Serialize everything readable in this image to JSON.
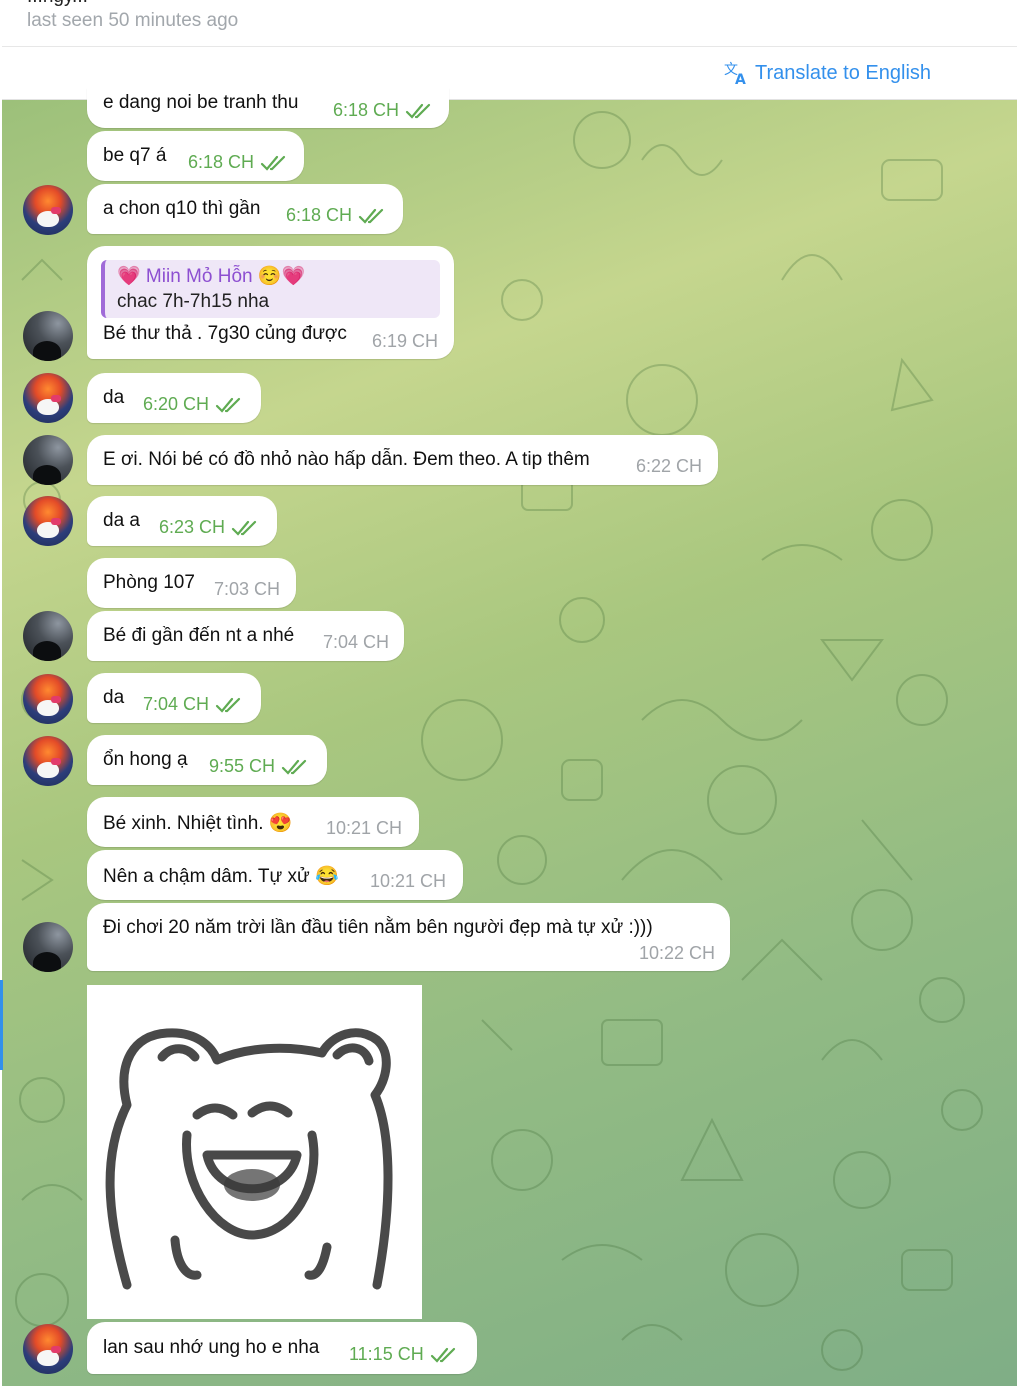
{
  "header": {
    "title": "...ngy...",
    "status": "last seen 50 minutes ago"
  },
  "translate": {
    "label": "Translate to English",
    "color": "#3390ec"
  },
  "colors": {
    "outgoing_time": "#5fab52",
    "incoming_time": "#a0a4a8",
    "quote_accent": "#a06bd8"
  },
  "messages": [
    {
      "text": "e dang noi be tranh thu",
      "time": "6:18 CH"
    },
    {
      "text": "be q7 á",
      "time": "6:18 CH"
    },
    {
      "text": "a chon q10 thì gần",
      "time": "6:18 CH"
    },
    {
      "text": "Bé thư thả . 7g30 củng được",
      "time": "6:19 CH",
      "reply": {
        "name": "💗 Miin Mỏ Hỗn ☺️💗",
        "text": "chac 7h-7h15 nha"
      }
    },
    {
      "text": "da",
      "time": "6:20 CH"
    },
    {
      "text": "E ơi. Nói bé có đồ nhỏ nào hấp dẫn. Đem theo. A tip thêm",
      "time": "6:22 CH"
    },
    {
      "text": "da a",
      "time": "6:23 CH"
    },
    {
      "text": "Phòng 107",
      "time": "7:03 CH"
    },
    {
      "text": "Bé đi gần đến nt a nhé",
      "time": "7:04 CH"
    },
    {
      "text": "da",
      "time": "7:04 CH"
    },
    {
      "text": "ổn hong ạ",
      "time": "9:55 CH"
    },
    {
      "text": "Bé xinh. Nhiệt tình. 😍",
      "time": "10:21 CH"
    },
    {
      "text": "Nên a chậm dâm. Tự xử 😂",
      "time": "10:21 CH"
    },
    {
      "text": "Đi chơi 20 năm trời lần đầu tiên nằm bên người đẹp mà tự xử :)))",
      "time": "10:22 CH"
    },
    {
      "text": "lan sau nhớ ung ho e nha",
      "time": "11:15 CH"
    }
  ]
}
